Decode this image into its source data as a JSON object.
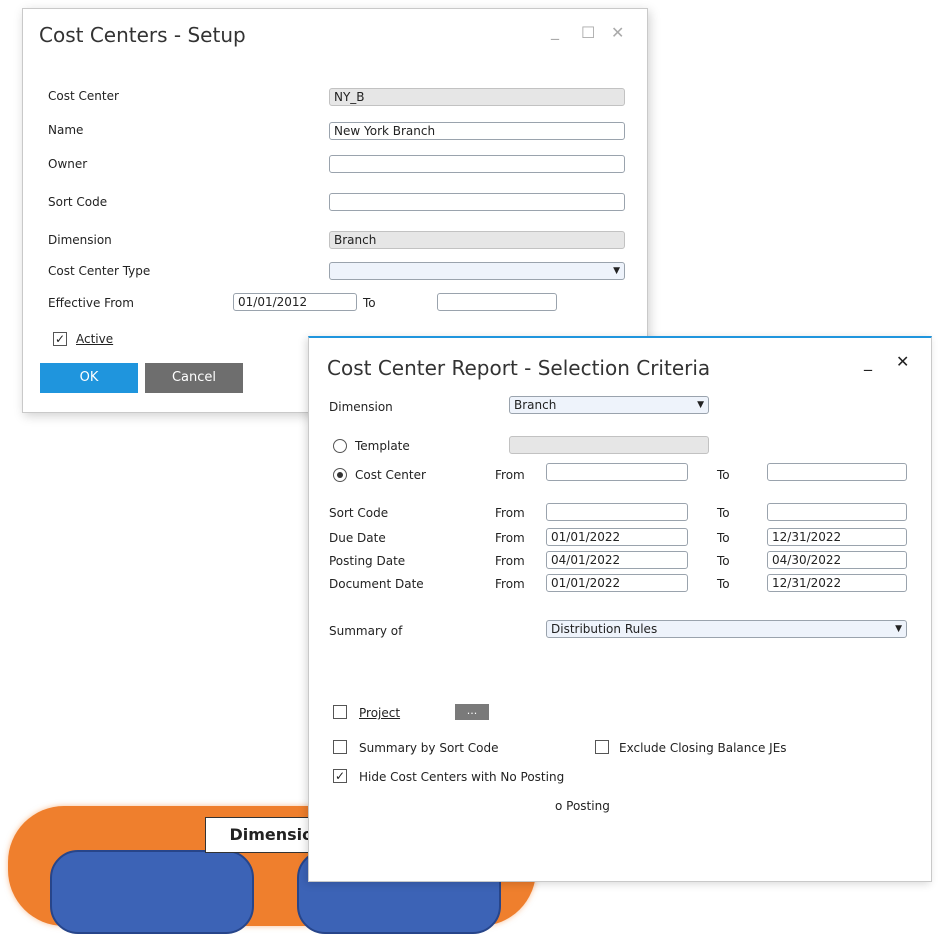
{
  "setup": {
    "title": "Cost Centers - Setup",
    "labels": {
      "cost_center": "Cost Center",
      "name": "Name",
      "owner": "Owner",
      "sort_code": "Sort Code",
      "dimension": "Dimension",
      "cost_center_type": "Cost Center Type",
      "effective_from": "Effective From",
      "to": "To",
      "active": "Active"
    },
    "values": {
      "cost_center": "NY_B",
      "name": "New York Branch",
      "owner": "",
      "sort_code": "",
      "dimension": "Branch",
      "cost_center_type": "",
      "effective_from": "01/01/2012",
      "effective_to": ""
    },
    "active_checked": true,
    "ok_label": "OK",
    "cancel_label": "Cancel"
  },
  "report": {
    "title": "Cost Center Report - Selection Criteria",
    "dimension_label": "Dimension",
    "dimension_value": "Branch",
    "template_label": "Template",
    "cost_center_label": "Cost Center",
    "from": "From",
    "to": "To",
    "rows": [
      {
        "label": "Sort Code",
        "from": "",
        "to": ""
      },
      {
        "label": "Due Date",
        "from": "01/01/2022",
        "to": "12/31/2022"
      },
      {
        "label": "Posting Date",
        "from": "04/01/2022",
        "to": "04/30/2022"
      },
      {
        "label": "Document Date",
        "from": "01/01/2022",
        "to": "12/31/2022"
      }
    ],
    "summary_label": "Summary of",
    "summary_value": "Distribution Rules",
    "project_label": "Project",
    "ellipsis": "...",
    "summary_sort_label": "Summary by Sort Code",
    "exclude_label": "Exclude Closing Balance JEs",
    "hide_label": "Hide Cost Centers with No Posting",
    "partial_text": "o Posting"
  },
  "diagram": {
    "dimension_label": "Dimension"
  }
}
